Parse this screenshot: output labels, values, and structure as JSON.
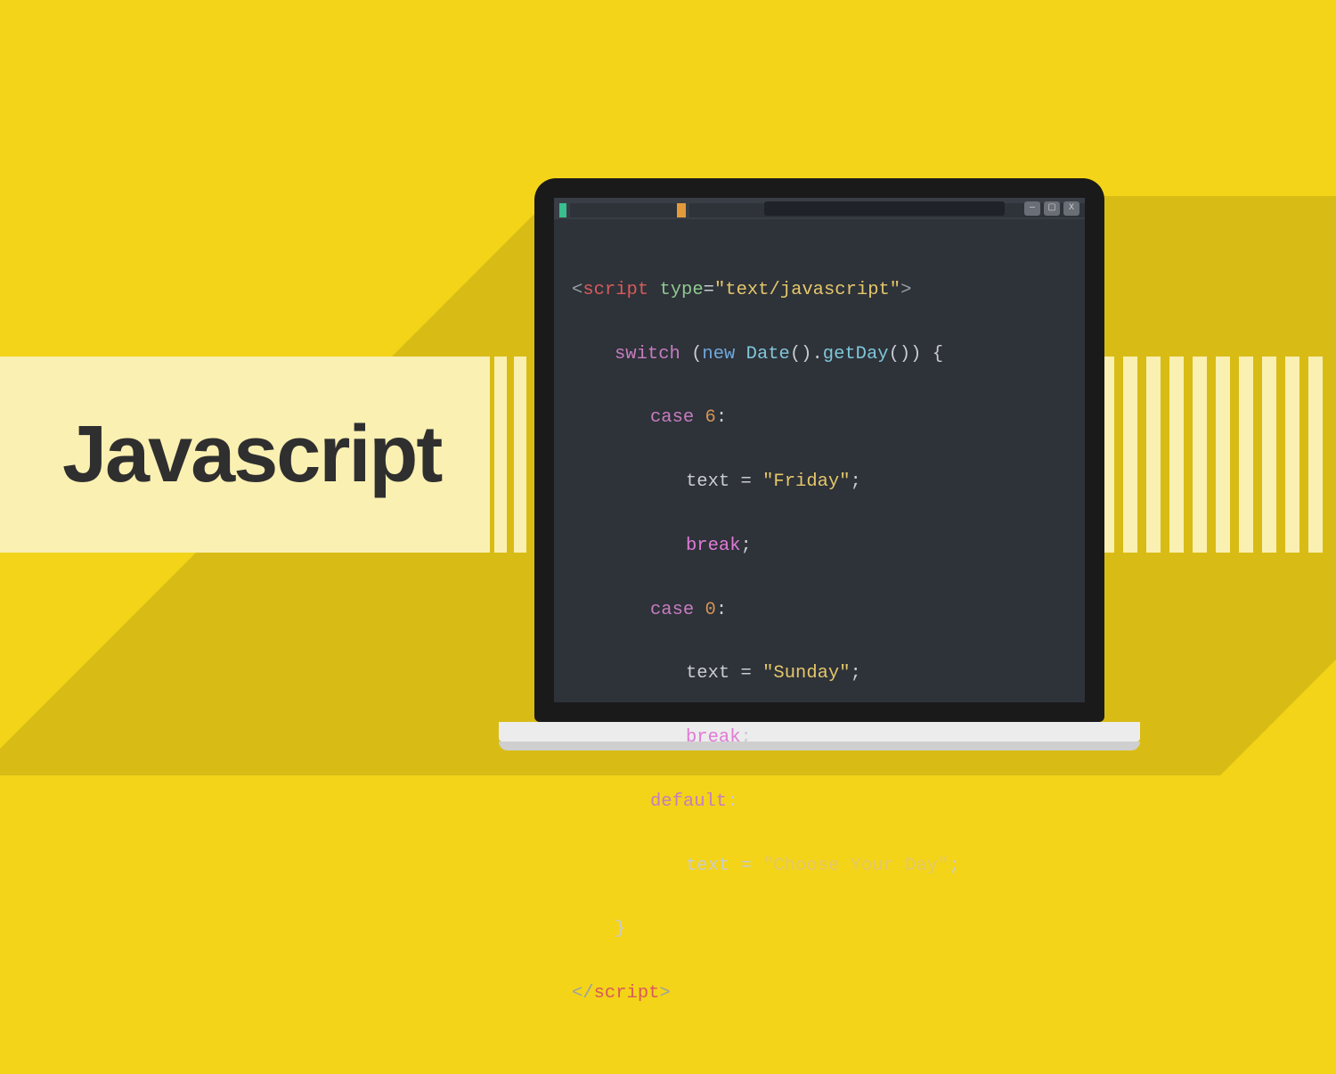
{
  "banner": {
    "title": "Javascript"
  },
  "window": {
    "buttons": {
      "min": "—",
      "max": "▢",
      "close": "X"
    }
  },
  "code": {
    "l1": {
      "open": "<",
      "tag": "script",
      "sp": " ",
      "attr": "type",
      "eq": "=",
      "val": "\"text/javascript\"",
      "close": ">"
    },
    "l2": {
      "kw": "switch",
      "sp": " (",
      "kw2": "new",
      "sp2": " ",
      "fn": "Date",
      "p": "().",
      "m": "getDay",
      "p2": "()) {"
    },
    "l3": {
      "kw": "case",
      "sp": " ",
      "num": "6",
      "colon": ":"
    },
    "l4": {
      "v": "text",
      "eq": " = ",
      "str": "\"Friday\"",
      "semi": ";"
    },
    "l5": {
      "kw": "break",
      "semi": ";"
    },
    "l6": {
      "kw": "case",
      "sp": " ",
      "num": "0",
      "colon": ":"
    },
    "l7": {
      "v": "text",
      "eq": " = ",
      "str": "\"Sunday\"",
      "semi": ";"
    },
    "l8": {
      "kw": "break",
      "semi": ";"
    },
    "l9": {
      "kw": "default",
      "colon": ":"
    },
    "l10": {
      "v": "text",
      "eq": " = ",
      "str": "\"Choose Your Day\"",
      "semi": ";"
    },
    "l11": {
      "brace": "}"
    },
    "l12": {
      "open": "</",
      "tag": "script",
      "close": ">"
    }
  }
}
